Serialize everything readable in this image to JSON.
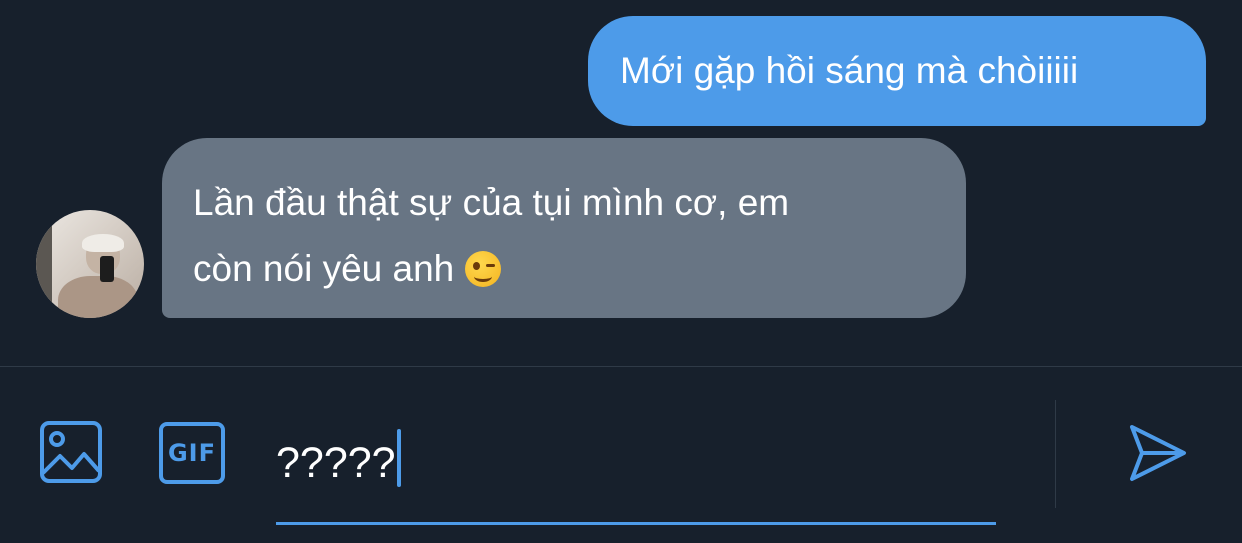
{
  "messages": [
    {
      "direction": "outgoing",
      "text": "Mới gặp hồi sáng mà chòiiiii"
    },
    {
      "direction": "incoming",
      "line1": "Lần đầu thật sự của tụi mình cơ, em",
      "line2": "còn nói yêu anh",
      "emoji": "winking-face"
    }
  ],
  "composer": {
    "value": "?????",
    "image_button_icon": "image-icon",
    "gif_label": "GIF",
    "send_icon": "send-icon"
  },
  "colors": {
    "background": "#17202c",
    "outgoing_bubble": "#4d9be9",
    "incoming_bubble": "#687584",
    "accent": "#4d9be9"
  }
}
